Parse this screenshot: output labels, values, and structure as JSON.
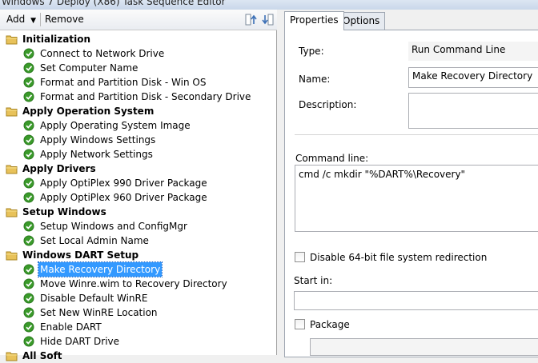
{
  "window": {
    "title": "Windows 7 Deploy (X86) Task Sequence Editor"
  },
  "toolbar": {
    "add_label": "Add",
    "remove_label": "Remove"
  },
  "tree": {
    "groups": [
      {
        "label": "Initialization",
        "steps": [
          "Connect to Network Drive",
          "Set Computer Name",
          "Format and Partition Disk - Win OS",
          "Format and Partition Disk - Secondary Drive"
        ]
      },
      {
        "label": "Apply Operation System",
        "steps": [
          "Apply Operating System Image",
          "Apply Windows Settings",
          "Apply Network Settings"
        ]
      },
      {
        "label": "Apply Drivers",
        "steps": [
          "Apply OptiPlex 990 Driver Package",
          "Apply OptiPlex 960 Driver Package"
        ]
      },
      {
        "label": "Setup Windows",
        "steps": [
          "Setup Windows and ConfigMgr",
          "Set Local Admin Name"
        ]
      },
      {
        "label": "Windows DART Setup",
        "steps": [
          "Make Recovery Directory",
          "Move Winre.wim to Recovery Directory",
          "Disable Default WinRE",
          "Set New WinRE Location",
          "Enable DART",
          "Hide DART Drive"
        ]
      },
      {
        "label": "All Soft",
        "steps": []
      }
    ],
    "selected": "Make Recovery Directory"
  },
  "tabs": [
    "Properties",
    "Options"
  ],
  "properties": {
    "type_label": "Type:",
    "type_value": "Run Command Line",
    "name_label": "Name:",
    "name_value": "Make Recovery Directory",
    "description_label": "Description:",
    "description_value": "",
    "command_line_label": "Command line:",
    "command_line_value": "cmd /c mkdir \"%DART%\\Recovery\"",
    "disable_64bit_label": "Disable 64-bit file system redirection",
    "disable_64bit_checked": false,
    "start_in_label": "Start in:",
    "start_in_value": "",
    "package_label": "Package",
    "package_checked": false,
    "package_value": ""
  },
  "colors": {
    "selection": "#3399ff",
    "step_check": "#3a9a2a",
    "folder": "#e8c25a"
  }
}
